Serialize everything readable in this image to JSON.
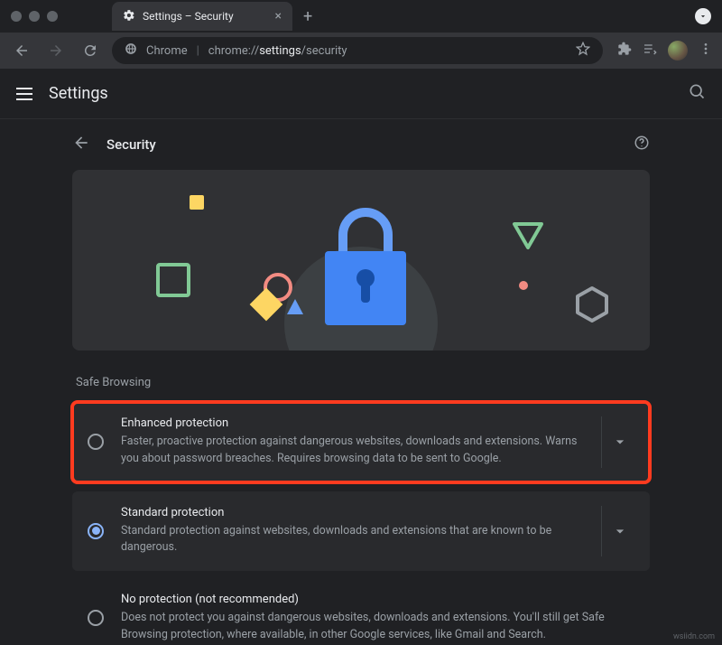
{
  "window": {
    "tab_title": "Settings – Security"
  },
  "toolbar": {
    "url_label": "Chrome",
    "url_scheme": "chrome://",
    "url_bold": "settings",
    "url_rest": "/security"
  },
  "settings_header": {
    "title": "Settings"
  },
  "page": {
    "title": "Security"
  },
  "section": {
    "label": "Safe Browsing",
    "options": [
      {
        "title": "Enhanced protection",
        "desc": "Faster, proactive protection against dangerous websites, downloads and extensions. Warns you about password breaches. Requires browsing data to be sent to Google.",
        "selected": false,
        "expandable": true,
        "highlighted": true
      },
      {
        "title": "Standard protection",
        "desc": "Standard protection against websites, downloads and extensions that are known to be dangerous.",
        "selected": true,
        "expandable": true,
        "highlighted": false
      },
      {
        "title": "No protection (not recommended)",
        "desc": "Does not protect you against dangerous websites, downloads and extensions. You'll still get Safe Browsing protection, where available, in other Google services, like Gmail and Search.",
        "selected": false,
        "expandable": false,
        "highlighted": false
      }
    ]
  },
  "watermark": "wsiidn.com"
}
